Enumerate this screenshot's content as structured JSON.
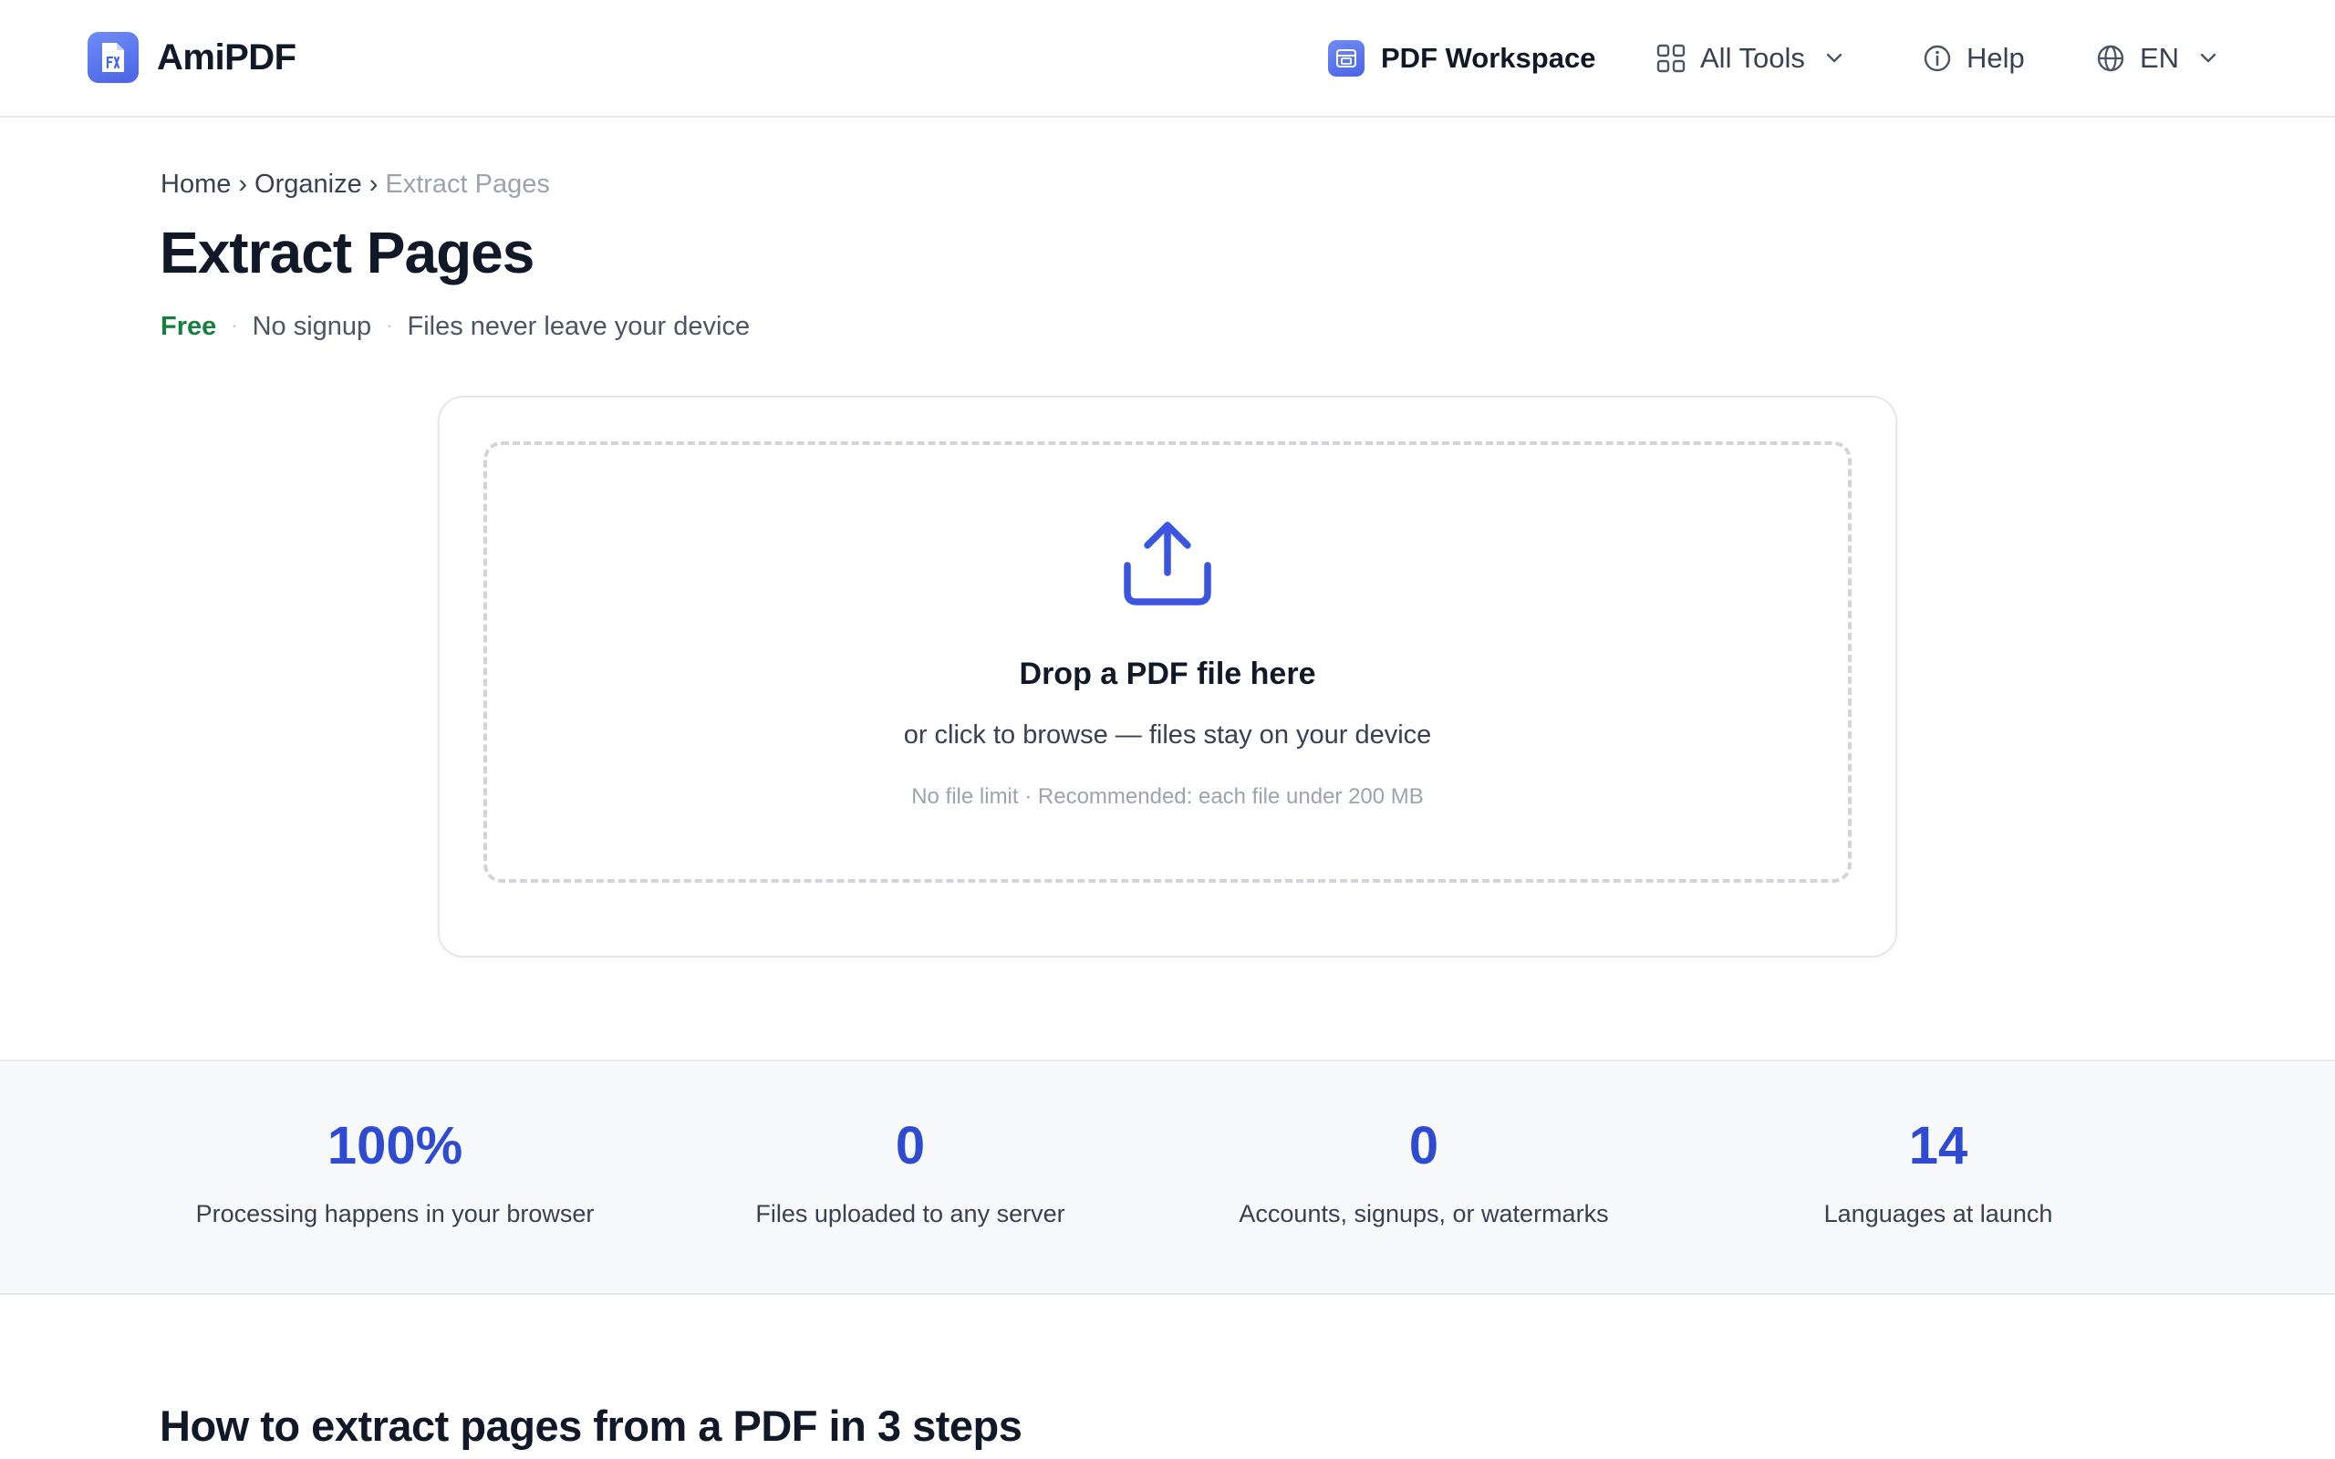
{
  "brand": {
    "name": "AmiPDF",
    "logo_icon": "pdf-file-icon",
    "accent_color": "#4a64e6"
  },
  "nav": {
    "workspace_label": "PDF Workspace",
    "all_tools_label": "All Tools",
    "help_label": "Help",
    "language_label": "EN"
  },
  "breadcrumb": {
    "items": [
      "Home",
      "Organize"
    ],
    "separator": "›",
    "current": "Extract Pages"
  },
  "page": {
    "title": "Extract Pages",
    "tagline": {
      "free": "Free",
      "no_signup": "No signup",
      "privacy": "Files never leave your device",
      "separator": "·"
    }
  },
  "upload": {
    "icon": "upload-icon",
    "title": "Drop a PDF file here",
    "subtitle": "or click to browse — files stay on your device",
    "note": "No file limit · Recommended: each file under 200 MB"
  },
  "stats": [
    {
      "value": "100%",
      "label": "Processing happens in your browser"
    },
    {
      "value": "0",
      "label": "Files uploaded to any server"
    },
    {
      "value": "0",
      "label": "Accounts, signups, or watermarks"
    },
    {
      "value": "14",
      "label": "Languages at launch"
    }
  ],
  "steps": {
    "heading": "How to extract pages from a PDF in 3 steps"
  }
}
